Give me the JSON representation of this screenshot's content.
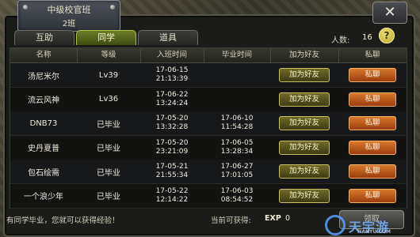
{
  "window": {
    "title_line1": "中级校官班",
    "title_line2": "2班",
    "close_icon": "close-x-icon"
  },
  "tabs": [
    {
      "label": "互助",
      "active": false
    },
    {
      "label": "同学",
      "active": true
    },
    {
      "label": "道具",
      "active": false
    }
  ],
  "members": {
    "label": "人数:",
    "value": "16",
    "help_icon": "question-icon"
  },
  "table": {
    "headers": [
      "名称",
      "等级",
      "入班时间",
      "毕业时间",
      "加为好友",
      "私聊"
    ],
    "rows": [
      {
        "name": "汤尼米尔",
        "level": "Lv39",
        "join_date": "17-06-15",
        "join_time": "21:13:39",
        "grad_date": "",
        "grad_time": "",
        "add_label": "加为好友",
        "chat_label": "私聊"
      },
      {
        "name": "流云风神",
        "level": "Lv36",
        "join_date": "17-06-22",
        "join_time": "13:24:24",
        "grad_date": "",
        "grad_time": "",
        "add_label": "加为好友",
        "chat_label": "私聊"
      },
      {
        "name": "DNB73",
        "level": "已毕业",
        "join_date": "17-05-20",
        "join_time": "13:32:28",
        "grad_date": "17-06-10",
        "grad_time": "11:54:28",
        "add_label": "加为好友",
        "chat_label": "私聊"
      },
      {
        "name": "史丹夏普",
        "level": "已毕业",
        "join_date": "17-05-20",
        "join_time": "23:21:09",
        "grad_date": "17-06-05",
        "grad_time": "13:28:34",
        "add_label": "加为好友",
        "chat_label": "私聊"
      },
      {
        "name": "包石绘需",
        "level": "已毕业",
        "join_date": "17-05-21",
        "join_time": "21:55:34",
        "grad_date": "17-06-27",
        "grad_time": "17:01:05",
        "add_label": "加为好友",
        "chat_label": "私聊"
      },
      {
        "name": "一个浪少年",
        "level": "已毕业",
        "join_date": "17-05-22",
        "join_time": "12:14:22",
        "grad_date": "17-06-03",
        "grad_time": "08:54:52",
        "add_label": "加为好友",
        "chat_label": "私聊"
      }
    ]
  },
  "footer": {
    "tip": "有同学毕业，您就可以获得经验！",
    "exp_prefix": "当前可获得:",
    "exp_key": "EXP",
    "exp_value": "0",
    "claim_label": "领取"
  },
  "watermark": {
    "name": "天宇游",
    "sub": "TIANYU.COM"
  }
}
